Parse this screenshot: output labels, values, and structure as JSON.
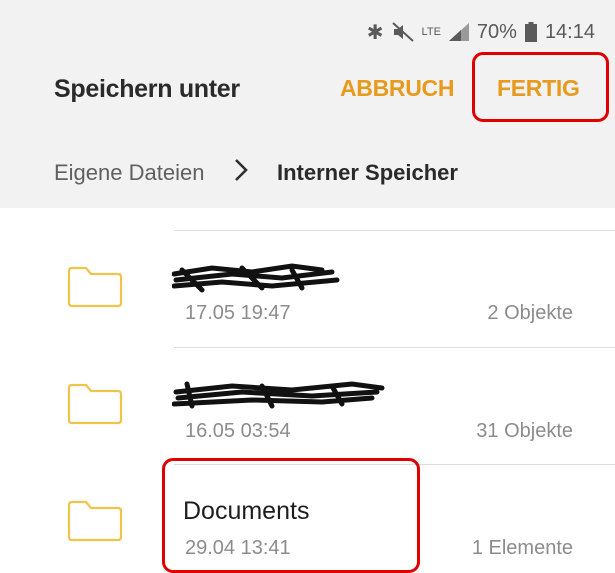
{
  "status": {
    "bluetooth": "✱",
    "mute": "🔇",
    "network": "LTE",
    "battery": "70%",
    "time": "14:14"
  },
  "header": {
    "title": "Speichern unter",
    "cancel_label": "ABBRUCH",
    "done_label": "FERTIG"
  },
  "breadcrumb": {
    "root": "Eigene Dateien",
    "separator": "›",
    "current": "Interner Speicher"
  },
  "folders": [
    {
      "name": "",
      "date": "17.05 19:47",
      "count": "2 Objekte",
      "redacted": true
    },
    {
      "name": "",
      "date": "16.05 03:54",
      "count": "31 Objekte",
      "redacted": true
    },
    {
      "name": "Documents",
      "date": "29.04 13:41",
      "count": "1 Elemente",
      "redacted": false
    }
  ],
  "colors": {
    "accent": "#e89a1c",
    "highlight": "#e00000",
    "folder_stroke": "#f0c44a",
    "header_bg": "#f2f2f2"
  }
}
